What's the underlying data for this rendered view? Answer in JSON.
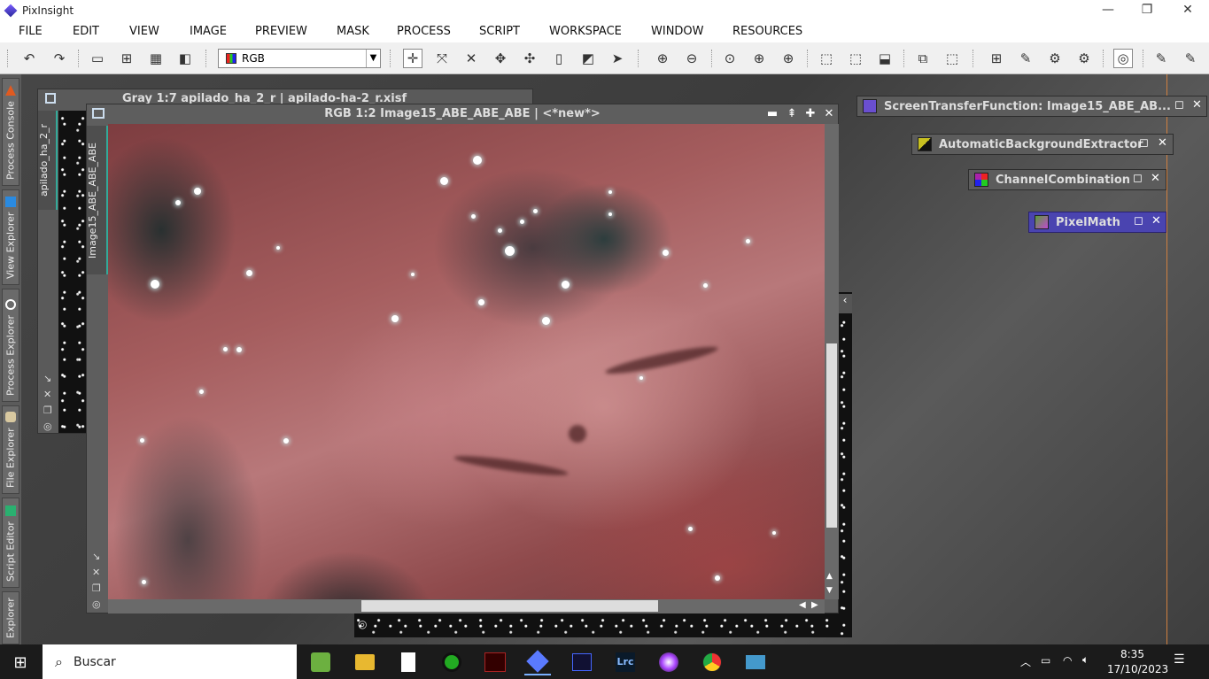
{
  "app": {
    "title": "PixInsight"
  },
  "window_controls": {
    "minimize": "—",
    "restore": "❐",
    "close": "✕"
  },
  "menu": [
    "FILE",
    "EDIT",
    "VIEW",
    "IMAGE",
    "PREVIEW",
    "MASK",
    "PROCESS",
    "SCRIPT",
    "WORKSPACE",
    "WINDOW",
    "RESOURCES"
  ],
  "toolbar": {
    "channel_select": "RGB"
  },
  "left_tabs": [
    "Process Console",
    "View Explorer",
    "Process Explorer",
    "File Explorer",
    "Script Editor",
    "Explorer"
  ],
  "bg_window": {
    "title": "Gray 1:7 apilado_ha_2_r | apilado-ha-2_r.xisf",
    "tab": "apilado_ha_2_r"
  },
  "main_window": {
    "title": "RGB 1:2 Image15_ABE_ABE_ABE | <*new*>",
    "tab": "Image15_ABE_ABE_ABE"
  },
  "iconized": [
    {
      "label": "ScreenTransferFunction: Image15_ABE_AB...",
      "color": "#6a4fd0"
    },
    {
      "label": "AutomaticBackgroundExtractor",
      "color": "#c8c020"
    },
    {
      "label": "ChannelCombination",
      "color": "#3a6ad0"
    },
    {
      "label": "PixelMath",
      "color": "#5a9a3a"
    }
  ],
  "taskbar": {
    "search_placeholder": "Buscar",
    "time": "8:35",
    "date": "17/10/2023"
  },
  "colors": {
    "accent": "#4a44b0",
    "workspace": "#404040",
    "taskbar": "#1b1b1b"
  }
}
